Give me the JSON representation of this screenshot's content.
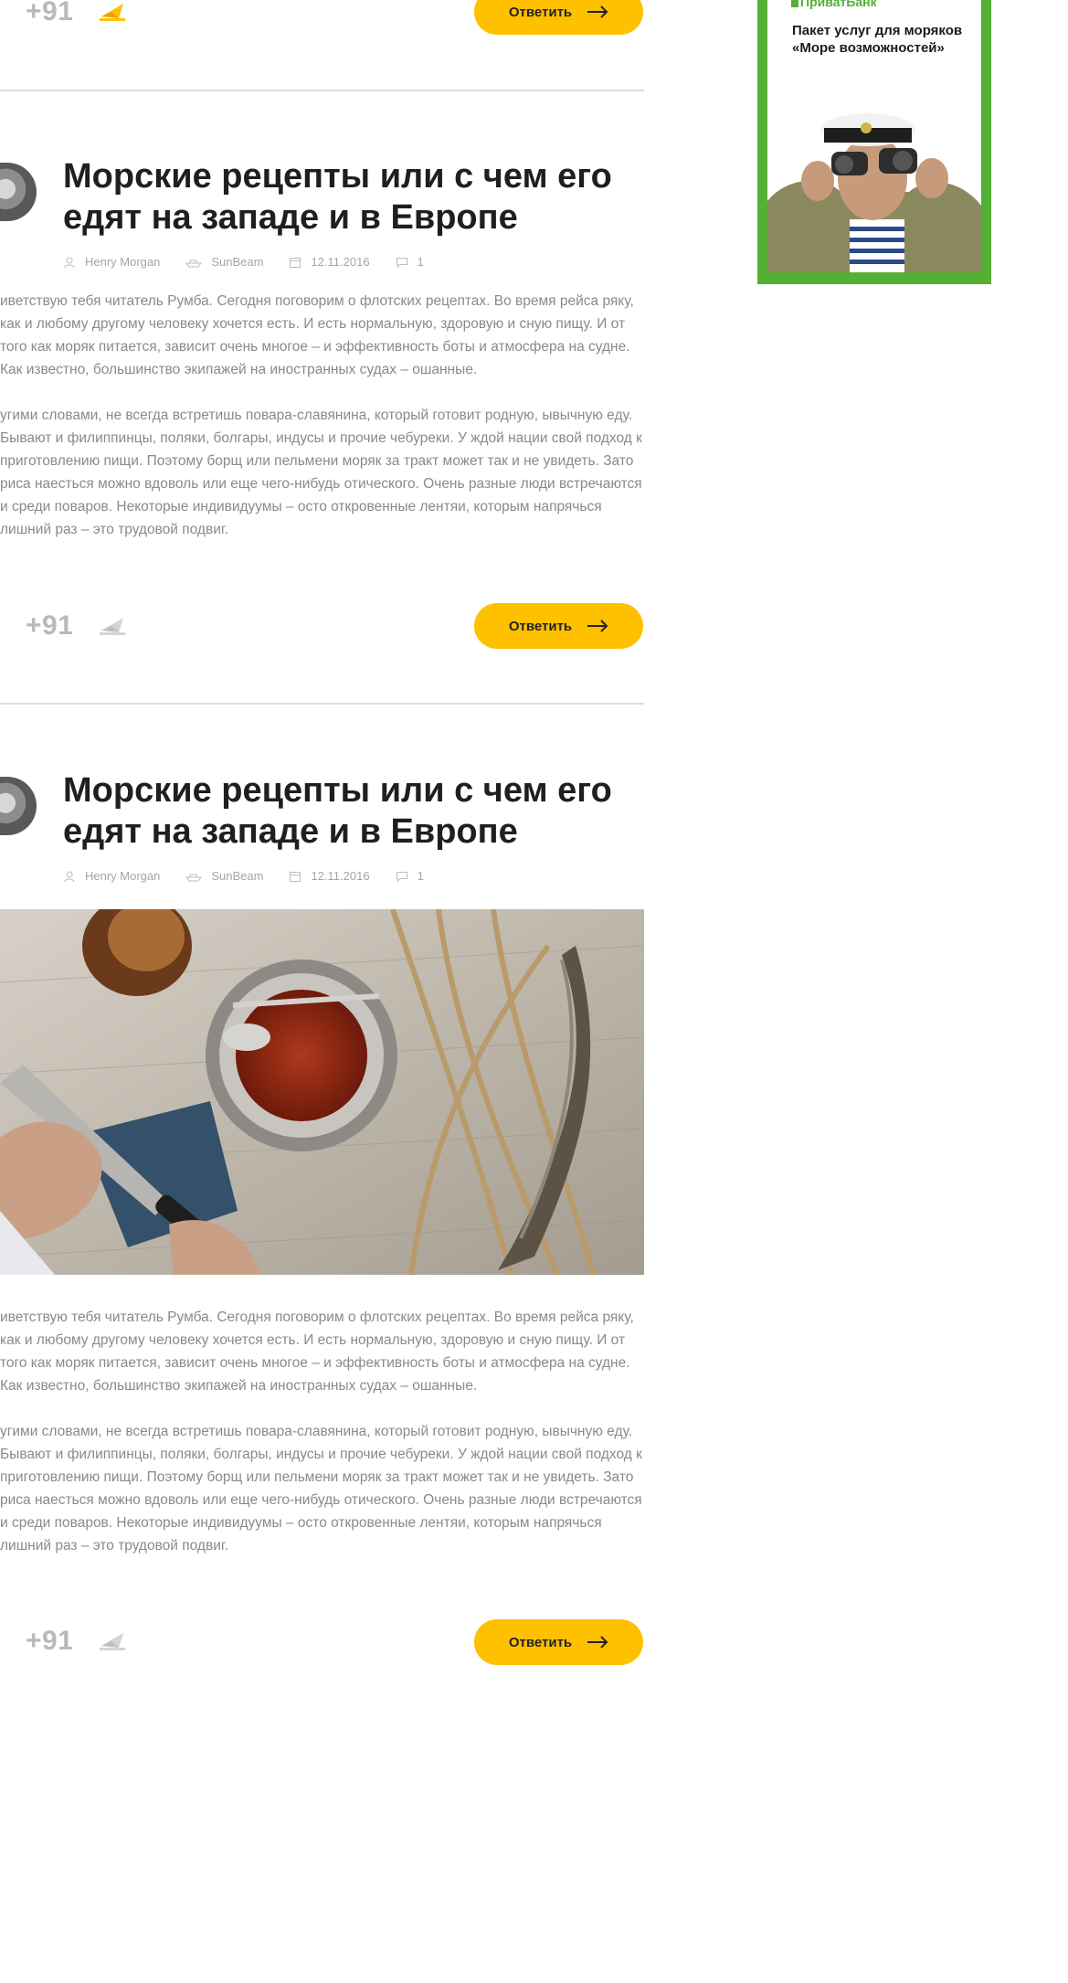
{
  "posts": [
    {
      "score": "+91",
      "reply_label": "Ответить"
    },
    {
      "title": "Морские рецепты или с чем его едят на западе и в Европе",
      "author": "Henry Morgan",
      "ship": "SunBeam",
      "date": "12.11.2016",
      "comments": "1",
      "paragraphs": [
        "иветствую тебя читатель Румба. Сегодня поговорим о флотских рецептах. Во время рейса ряку, как и любому другому человеку хочется есть. И есть нормальную, здоровую и сную пищу. И от того как моряк питается, зависит очень многое – и эффективность боты и атмосфера на судне. Как известно, большинство экипажей на иностранных судах – ошанные.",
        "угими словами, не всегда встретишь повара-славянина, который готовит родную, ывычную еду. Бывают и филиппинцы, поляки, болгары, индусы и прочие чебуреки. У ждой нации свой подход к приготовлению пищи. Поэтому борщ или пельмени моряк за тракт может так и не увидеть. Зато риса наесться можно вдоволь или еще чего-нибудь отического. Очень разные люди встречаются и среди поваров. Некоторые индивидуумы – осто откровенные лентяи, которым напрячься лишний раз – это трудовой подвиг."
      ],
      "score": "+91",
      "reply_label": "Ответить"
    },
    {
      "title": "Морские рецепты или с чем его едят на западе и в Европе",
      "author": "Henry Morgan",
      "ship": "SunBeam",
      "date": "12.11.2016",
      "comments": "1",
      "paragraphs": [
        "иветствую тебя читатель Румба. Сегодня поговорим о флотских рецептах. Во время рейса ряку, как и любому другому человеку хочется есть. И есть нормальную, здоровую и сную пищу. И от того как моряк питается, зависит очень многое – и эффективность боты и атмосфера на судне. Как известно, большинство экипажей на иностранных судах – ошанные.",
        "угими словами, не всегда встретишь повара-славянина, который готовит родную, ывычную еду. Бывают и филиппинцы, поляки, болгары, индусы и прочие чебуреки. У ждой нации свой подход к приготовлению пищи. Поэтому борщ или пельмени моряк за тракт может так и не увидеть. Зато риса наесться можно вдоволь или еще чего-нибудь отического. Очень разные люди встречаются и среди поваров. Некоторые индивидуумы – осто откровенные лентяи, которым напрячься лишний раз – это трудовой подвиг."
      ],
      "score": "+91",
      "reply_label": "Ответить"
    }
  ],
  "ad": {
    "bank": "ПриватБанк",
    "text": "Пакет услуг для моряков «Море возможностей»"
  },
  "colors": {
    "accent": "#ffc000",
    "ad_green": "#53b033",
    "vote_active": "#ffc000",
    "vote_inactive": "#cfcfcf"
  },
  "icons": [
    "user-icon",
    "ship-icon",
    "calendar-icon",
    "comment-icon",
    "vote-icon",
    "arrow-right-icon"
  ]
}
